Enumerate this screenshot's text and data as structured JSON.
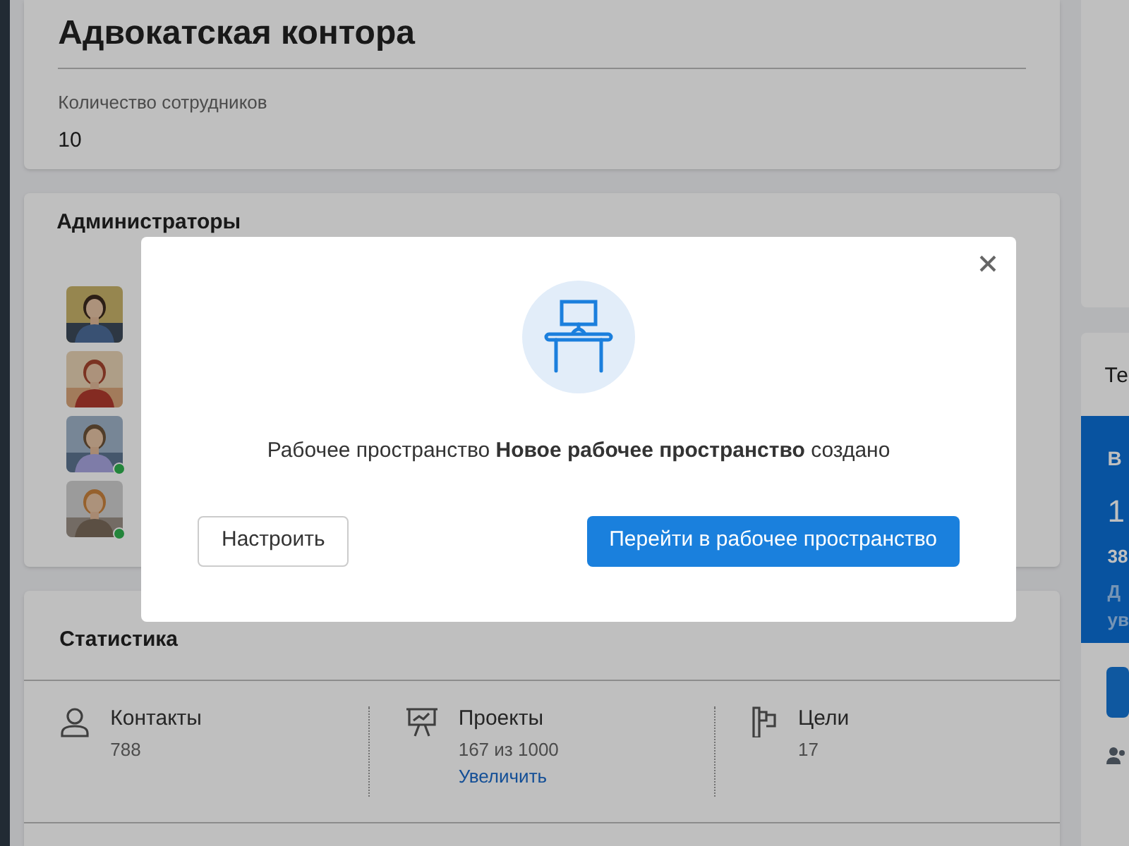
{
  "company": {
    "title": "Адвокатская контора",
    "employees_label": "Количество сотрудников",
    "employees_value": "10"
  },
  "admins": {
    "title": "Администраторы",
    "avatars": [
      {
        "kind": "picture",
        "online": false
      },
      {
        "kind": "picture",
        "online": false
      },
      {
        "kind": "picture",
        "online": true
      },
      {
        "kind": "picture",
        "online": true
      }
    ]
  },
  "stats": {
    "title": "Статистика",
    "items": [
      {
        "kind": "contacts",
        "label": "Контакты",
        "value": "788"
      },
      {
        "kind": "projects",
        "label": "Проекты",
        "value": "167 из 1000",
        "link": "Увеличить"
      },
      {
        "kind": "goals",
        "label": "Цели",
        "value": "17"
      }
    ]
  },
  "right_panel": {
    "heading": "Те",
    "promo": {
      "title": "В",
      "big": "1",
      "sub": "38",
      "note_lines": [
        "Д",
        "ув"
      ]
    }
  },
  "dialog": {
    "message": "Рабочее пространство **Новое рабочее пространство** создано",
    "secondary_button": "Настроить",
    "primary_button": "Перейти в рабочее пространство"
  }
}
